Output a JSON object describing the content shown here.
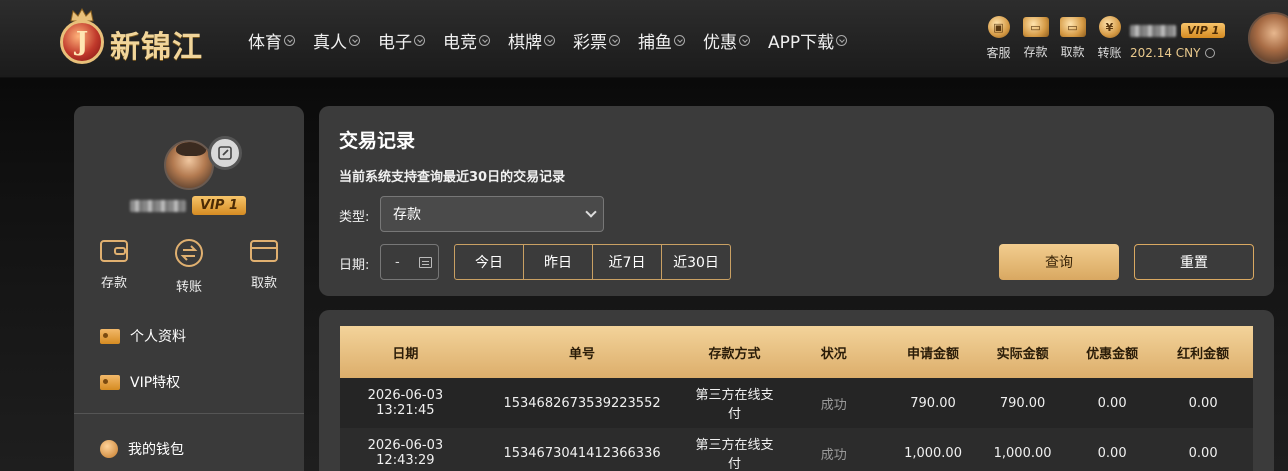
{
  "brand": {
    "name": "新锦江",
    "badge_letter": "J"
  },
  "nav": [
    {
      "label": "体育"
    },
    {
      "label": "真人"
    },
    {
      "label": "电子"
    },
    {
      "label": "电竞"
    },
    {
      "label": "棋牌"
    },
    {
      "label": "彩票"
    },
    {
      "label": "捕鱼"
    },
    {
      "label": "优惠"
    },
    {
      "label": "APP下载"
    }
  ],
  "quick": [
    {
      "label": "客服",
      "icon": "customer-service-icon"
    },
    {
      "label": "存款",
      "icon": "deposit-icon"
    },
    {
      "label": "取款",
      "icon": "withdraw-icon"
    },
    {
      "label": "转账",
      "icon": "transfer-icon"
    }
  ],
  "user": {
    "vip": "VIP 1",
    "balance": "202.14 CNY"
  },
  "sidebar": {
    "actions": [
      {
        "label": "存款"
      },
      {
        "label": "转账"
      },
      {
        "label": "取款"
      }
    ],
    "menu": [
      {
        "label": "个人资料"
      },
      {
        "label": "VIP特权"
      }
    ],
    "wallet": {
      "label": "我的钱包"
    }
  },
  "panel": {
    "title": "交易记录",
    "note": "当前系统支持查询最近30日的交易记录",
    "type_label": "类型:",
    "type_value": "存款",
    "date_label": "日期:",
    "date_value": "-",
    "ranges": [
      {
        "label": "今日"
      },
      {
        "label": "昨日"
      },
      {
        "label": "近7日"
      },
      {
        "label": "近30日"
      }
    ],
    "query": "查询",
    "reset": "重置"
  },
  "table": {
    "headers": [
      "日期",
      "单号",
      "存款方式",
      "状况",
      "申请金额",
      "实际金额",
      "优惠金额",
      "红利金额"
    ],
    "rows": [
      [
        "2026-06-03 13:21:45",
        "1534682673539223552",
        "第三方在线支付",
        "成功",
        "790.00",
        "790.00",
        "0.00",
        "0.00"
      ],
      [
        "2026-06-03 12:43:29",
        "1534673041412366336",
        "第三方在线支付",
        "成功",
        "1,000.00",
        "1,000.00",
        "0.00",
        "0.00"
      ]
    ]
  },
  "colors": {
    "accent": "#d9a861",
    "panel": "#3b3b3b",
    "vip": "#e9a440"
  }
}
